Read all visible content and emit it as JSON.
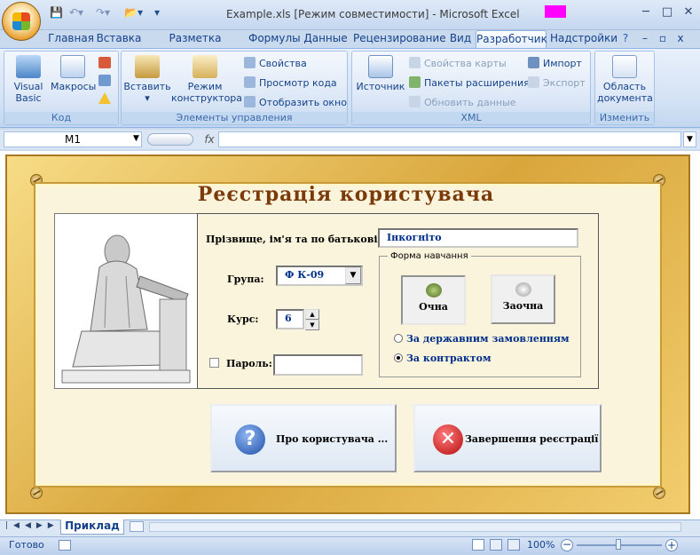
{
  "window": {
    "title": "Example.xls  [Режим совместимости] - Microsoft Excel"
  },
  "tabs": [
    "Главная",
    "Вставка",
    "Разметка страницы",
    "Формулы",
    "Данные",
    "Рецензирование",
    "Вид",
    "Разработчик",
    "Надстройки"
  ],
  "ribbon": {
    "code": {
      "label": "Код",
      "visual_basic": "Visual Basic",
      "macros": "Макросы"
    },
    "controls": {
      "label": "Элементы управления",
      "insert": "Вставить",
      "design_mode": "Режим конструктора",
      "properties": "Свойства",
      "view_code": "Просмотр кода",
      "show_window": "Отобразить окно"
    },
    "xml": {
      "label": "XML",
      "source": "Источник",
      "map_props": "Свойства карты",
      "packs": "Пакеты расширения",
      "refresh": "Обновить данные",
      "import": "Импорт",
      "export": "Экспорт"
    },
    "modify": {
      "label": "Изменить",
      "doc_panel": "Область документа"
    }
  },
  "formula_bar": {
    "name_box": "M1",
    "fx": "fx",
    "formula": ""
  },
  "form": {
    "title": "Реєстрація користувача",
    "name_label": "Прізвище, ім'я та по батькові:",
    "name_value": "Інкогніто",
    "group_label": "Група:",
    "group_value": "Ф К-09",
    "course_label": "Курс:",
    "course_value": "6",
    "password_label": "Пароль:",
    "study_frame": "Форма навчання",
    "fulltime": "Очна",
    "parttime": "Заочна",
    "budget": "За державним замовленням",
    "contract": "За контрактом",
    "about_button": "Про користувача ...",
    "finish_button": "Завершення реєстрації",
    "about_icon": "?",
    "finish_icon": "✕"
  },
  "sheet_tab": "Приклад",
  "status": {
    "ready": "Готово",
    "zoom": "100%"
  }
}
